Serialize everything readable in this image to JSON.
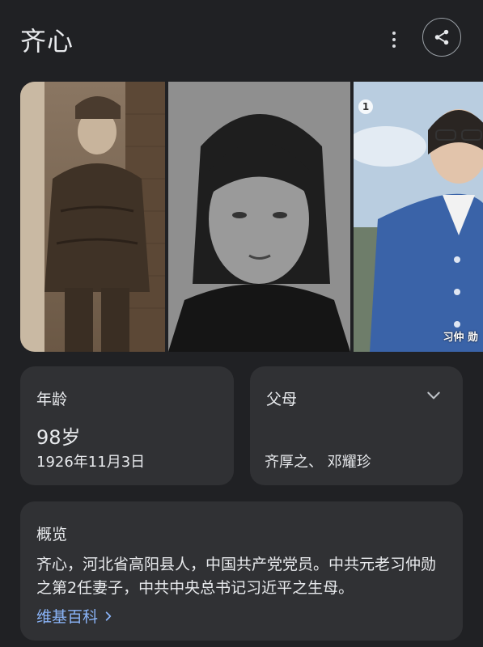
{
  "header": {
    "title": "齐心",
    "more_icon": "more-vert-icon",
    "share_icon": "share-icon"
  },
  "images": [
    {
      "alt": "",
      "watermark": ""
    },
    {
      "alt": ""
    },
    {
      "badge": "1",
      "caption": "习仲 勋"
    }
  ],
  "age_card": {
    "label": "年龄",
    "value": "98岁",
    "birth_date": "1926年11月3日"
  },
  "parents_card": {
    "label": "父母",
    "value": "齐厚之、 邓耀珍",
    "expand_icon": "chevron-down-icon"
  },
  "overview_card": {
    "label": "概览",
    "text": "齐心，河北省高阳县人，中国共产党党员。中共元老习仲勋之第2任妻子，中共中央总书记习近平之生母。",
    "source_link": "维基百科",
    "link_icon": "chevron-right-icon",
    "link_color": "#8ab4f8"
  },
  "colors": {
    "background": "#202124",
    "card": "#303134",
    "text": "#e8eaed",
    "accent": "#8ab4f8"
  }
}
